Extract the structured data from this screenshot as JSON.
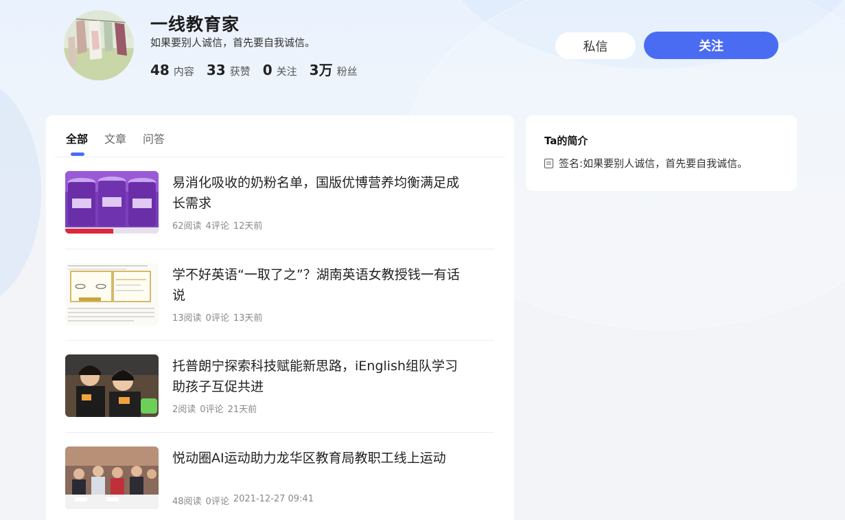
{
  "profile": {
    "name": "一线教育家",
    "signature": "如果要别人诚信，首先要自我诚信。",
    "stats": [
      {
        "num": "48",
        "label": "内容"
      },
      {
        "num": "33",
        "label": "获赞"
      },
      {
        "num": "0",
        "label": "关注"
      },
      {
        "num": "3万",
        "label": "粉丝"
      }
    ]
  },
  "actions": {
    "message_label": "私信",
    "follow_label": "关注"
  },
  "tabs": [
    {
      "label": "全部",
      "active": true
    },
    {
      "label": "文章",
      "active": false
    },
    {
      "label": "问答",
      "active": false
    }
  ],
  "articles": [
    {
      "title": "易消化吸收的奶粉名单，国版优博营养均衡满足成长需求",
      "reads": "62阅读",
      "comments": "4评论",
      "time": "12天前"
    },
    {
      "title": "学不好英语“一取了之”？湖南英语女教授钱一有话说",
      "reads": "13阅读",
      "comments": "0评论",
      "time": "13天前"
    },
    {
      "title": "托普朗宁探索科技赋能新思路，iEnglish组队学习助孩子互促共进",
      "reads": "2阅读",
      "comments": "0评论",
      "time": "21天前"
    },
    {
      "title": "悦动圈AI运动助力龙华区教育局教职工线上运动",
      "reads": "48阅读",
      "comments": "0评论",
      "time": "2021-12-27 09:41"
    }
  ],
  "sidebar": {
    "title": "Ta的简介",
    "sign_label": "签名: ",
    "sign_value": "如果要别人诚信，首先要自我诚信。"
  },
  "colors": {
    "accent": "#4a6cf2",
    "background": "#eef3fa",
    "card": "#ffffff"
  }
}
